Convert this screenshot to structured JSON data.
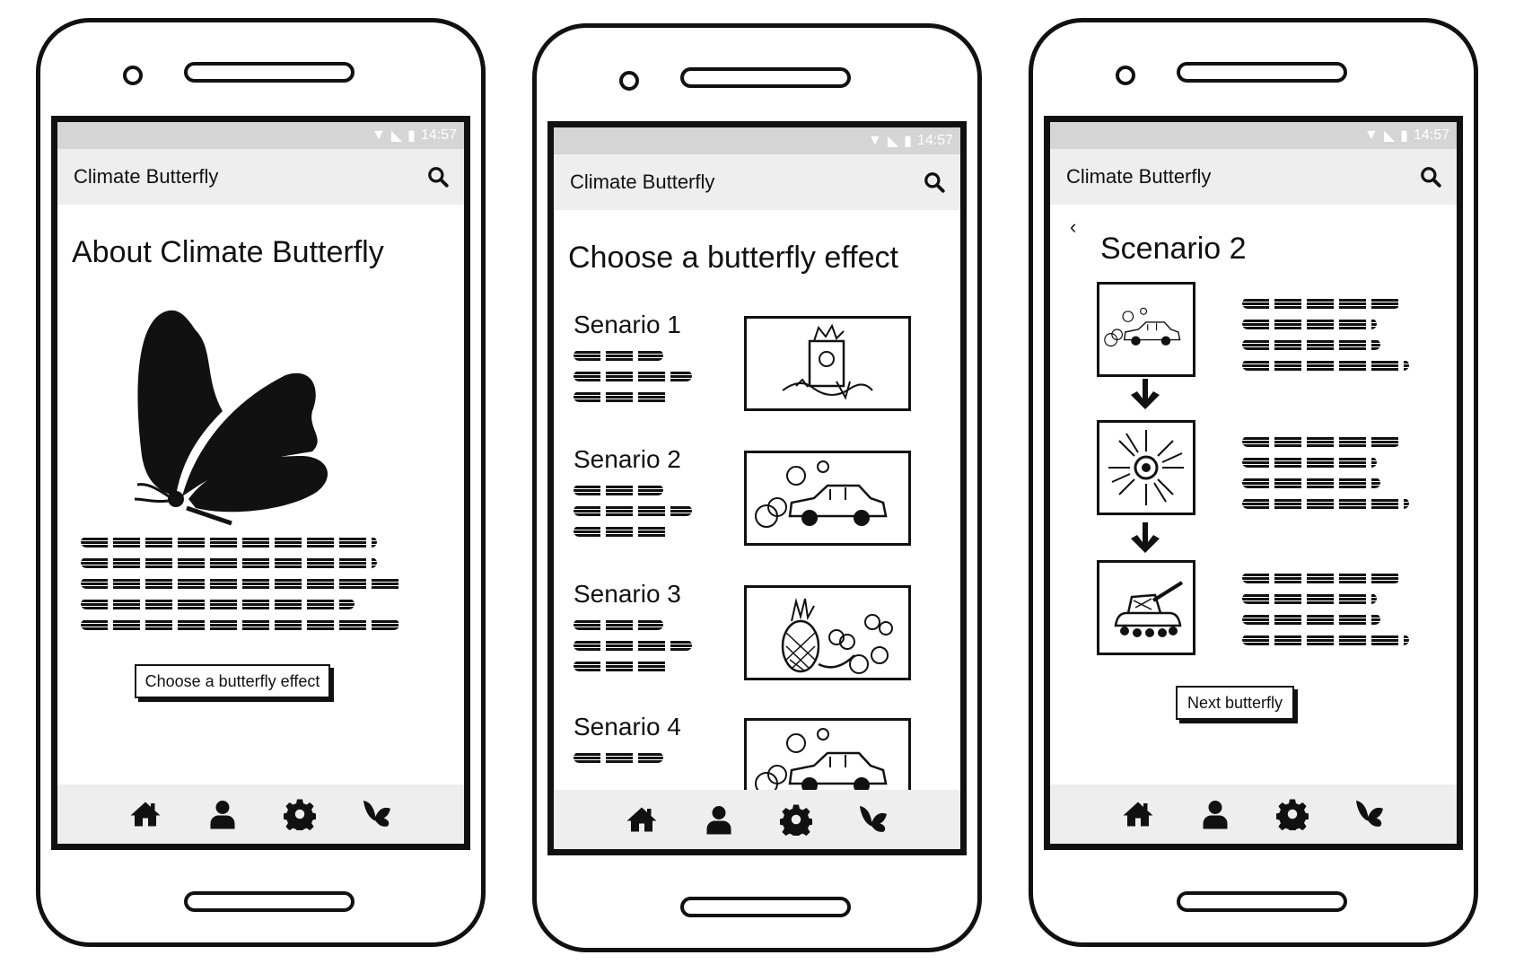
{
  "status": {
    "time": "14:57"
  },
  "app": {
    "title": "Climate Butterfly"
  },
  "screen1": {
    "heading": "About Climate Butterfly",
    "button_label": "Choose a butterfly effect"
  },
  "screen2": {
    "heading": "Choose a butterfly effect",
    "scenarios": [
      {
        "label": "Senario 1",
        "image": "trash-can-sketch"
      },
      {
        "label": "Senario 2",
        "image": "car-exhaust-sketch"
      },
      {
        "label": "Senario 3",
        "image": "fruit-sketch"
      },
      {
        "label": "Senario 4",
        "image": "car-exhaust-sketch"
      }
    ]
  },
  "screen3": {
    "heading": "Scenario 2",
    "button_label": "Next butterfly",
    "flow": [
      "car-exhaust-sketch",
      "sun-sketch",
      "tank-sketch"
    ]
  },
  "nav": {
    "items": [
      "home-icon",
      "user-icon",
      "gear-icon",
      "butterfly-icon"
    ]
  },
  "colors": {
    "statusbar": "#d5d5d5",
    "appbar": "#eeeeee",
    "ink": "#111111"
  }
}
